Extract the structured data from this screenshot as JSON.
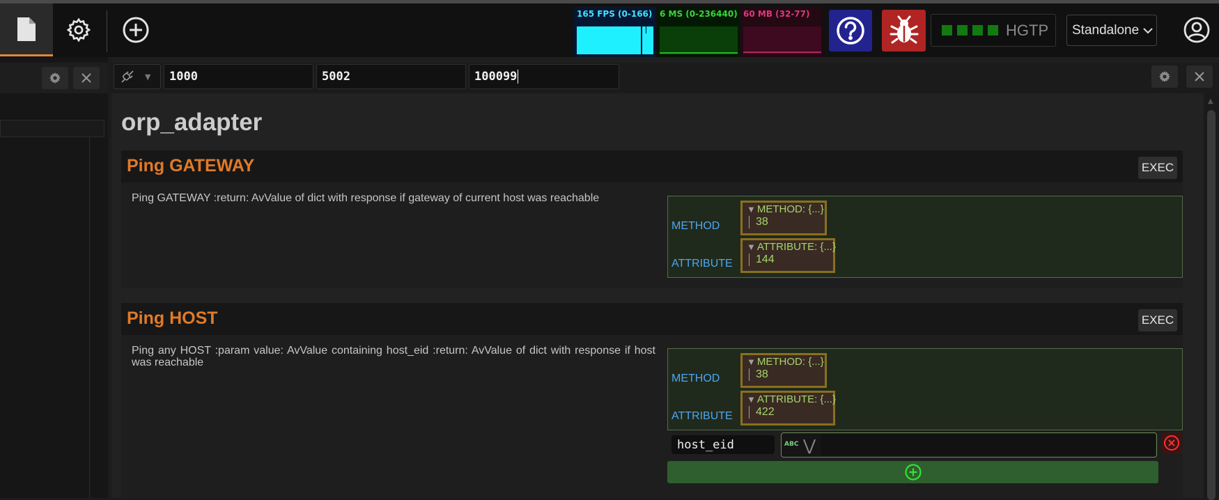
{
  "topbar": {
    "perf": {
      "fps_label": "165 FPS (0-166)",
      "ms_label": "6 MS (0-236440)",
      "mb_label": "60 MB (32-77)"
    },
    "connection": {
      "label": "HGTP",
      "indicator_count": 4,
      "indicator_color": "#117a11"
    },
    "mode_select": {
      "selected": "Standalone"
    }
  },
  "toolbar": {
    "inputs": [
      "1000",
      "5002",
      "100099"
    ]
  },
  "page": {
    "title": "orp_adapter",
    "sections": [
      {
        "title": "Ping GATEWAY",
        "exec_label": "EXEC",
        "description": "Ping GATEWAY :return: AvValue of dict with response if gateway of current host was reachable",
        "params": [
          {
            "key": "METHOD",
            "node_label": "METHOD: {...}",
            "value": "38"
          },
          {
            "key": "ATTRIBUTE",
            "node_label": "ATTRIBUTE: {...}",
            "value": "144"
          }
        ]
      },
      {
        "title": "Ping HOST",
        "exec_label": "EXEC",
        "description": "Ping any HOST :param value: AvValue containing host_eid :return: AvValue of dict with response if host was reachable",
        "params": [
          {
            "key": "METHOD",
            "node_label": "METHOD: {...}",
            "value": "38"
          },
          {
            "key": "ATTRIBUTE",
            "node_label": "ATTRIBUTE: {...}",
            "value": "422"
          }
        ],
        "args": [
          {
            "name": "host_eid",
            "type_badge": "ABC",
            "value": ""
          }
        ]
      }
    ]
  },
  "colors": {
    "accent_tab": "#e0883a",
    "section_title": "#e07a28",
    "param_key": "#4ea6f0",
    "param_value": "#a5d66a",
    "help_button": "#23238f",
    "bug_button": "#b02424"
  }
}
